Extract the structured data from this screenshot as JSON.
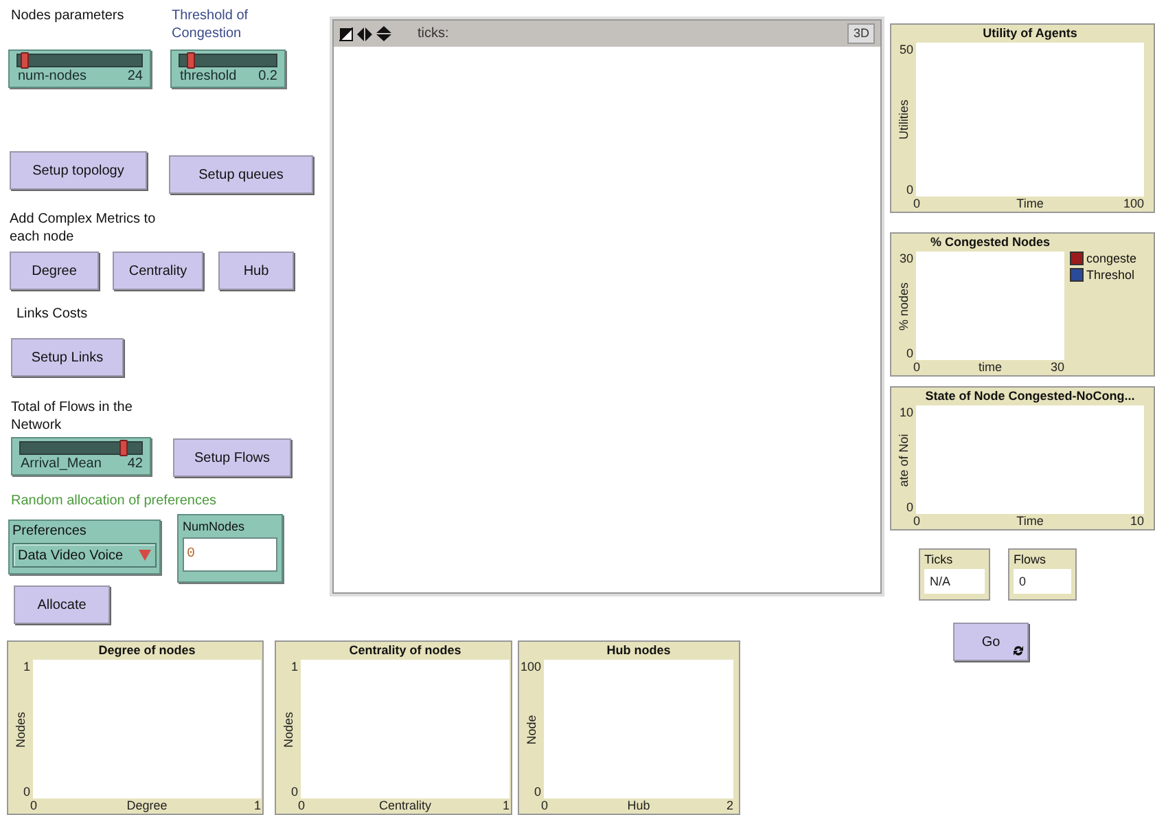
{
  "notes": [
    {
      "text": "Nodes parameters",
      "color": "#111111"
    },
    {
      "text": "Threshold of Congestion",
      "color": "#3a4a8a"
    },
    {
      "text": "Add Complex Metrics to each node",
      "color": "#111111"
    },
    {
      "text": "Links Costs",
      "color": "#111111"
    },
    {
      "text": "Total of Flows in the Network",
      "color": "#111111"
    },
    {
      "text": "Random allocation of preferences",
      "color": "#4a9a3a"
    }
  ],
  "sliders": [
    {
      "label": "num-nodes",
      "value": "24",
      "level": 0.05
    },
    {
      "label": "threshold",
      "value": "0.2",
      "level": 0.12
    },
    {
      "label": "Arrival_Mean",
      "value": "42",
      "level": 0.85
    }
  ],
  "buttons": [
    {
      "label": "Setup topology",
      "forever": false
    },
    {
      "label": "Setup queues",
      "forever": false
    },
    {
      "label": "Degree",
      "forever": false
    },
    {
      "label": "Centrality",
      "forever": false
    },
    {
      "label": "Hub",
      "forever": false
    },
    {
      "label": "Setup Links",
      "forever": false
    },
    {
      "label": "Setup Flows",
      "forever": false
    },
    {
      "label": "Allocate",
      "forever": false
    },
    {
      "label": "Go",
      "forever": true
    }
  ],
  "chooser": {
    "label": "Preferences",
    "value": "Data Video Voice"
  },
  "input": {
    "label": "NumNodes",
    "value": "0"
  },
  "view": {
    "ticks_label": "ticks:",
    "button_3d": "3D"
  },
  "plots": [
    {
      "title": "Utility of Agents",
      "xlabel": "Time",
      "ylabel": "Utilities",
      "x_min": "0",
      "x_max": "100",
      "y_min": "0",
      "y_max": "50"
    },
    {
      "title": "% Congested Nodes",
      "xlabel": "time",
      "ylabel": "% nodes",
      "x_min": "0",
      "x_max": "30",
      "y_min": "0",
      "y_max": "30",
      "legend": [
        {
          "name": "congeste",
          "color": "#9a1c1c"
        },
        {
          "name": "Threshol",
          "color": "#2a4a9a"
        }
      ]
    },
    {
      "title": "State of Node Congested-NoCong...",
      "xlabel": "Time",
      "ylabel": "ate of Noi",
      "x_min": "0",
      "x_max": "10",
      "y_min": "0",
      "y_max": "10"
    },
    {
      "title": "Degree of nodes",
      "xlabel": "Degree",
      "ylabel": "Nodes",
      "x_min": "0",
      "x_max": "1",
      "y_min": "0",
      "y_max": "1"
    },
    {
      "title": "Centrality of nodes",
      "xlabel": "Centrality",
      "ylabel": "Nodes",
      "x_min": "0",
      "x_max": "1",
      "y_min": "0",
      "y_max": "1"
    },
    {
      "title": "Hub nodes",
      "xlabel": "Hub",
      "ylabel": "Node",
      "x_min": "0",
      "x_max": "2",
      "y_min": "0",
      "y_max": "100"
    }
  ],
  "monitors": [
    {
      "label": "Ticks",
      "value": "N/A"
    },
    {
      "label": "Flows",
      "value": "0"
    }
  ]
}
